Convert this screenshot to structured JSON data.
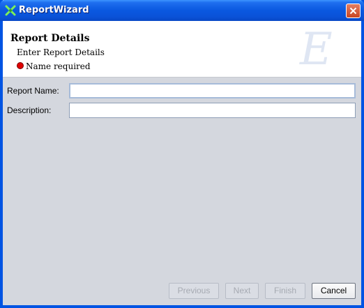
{
  "window": {
    "title": "ReportWizard"
  },
  "header": {
    "title": "Report Details",
    "subtitle": "Enter Report Details",
    "error": "Name required"
  },
  "form": {
    "report_name_label": "Report Name:",
    "report_name_value": "",
    "description_label": "Description:",
    "description_value": ""
  },
  "buttons": {
    "previous": "Previous",
    "next": "Next",
    "finish": "Finish",
    "cancel": "Cancel"
  },
  "colors": {
    "titlebar": "#0a58e0",
    "close_button": "#c94521",
    "error_indicator": "#e00000",
    "body_background": "#d4d7de"
  }
}
